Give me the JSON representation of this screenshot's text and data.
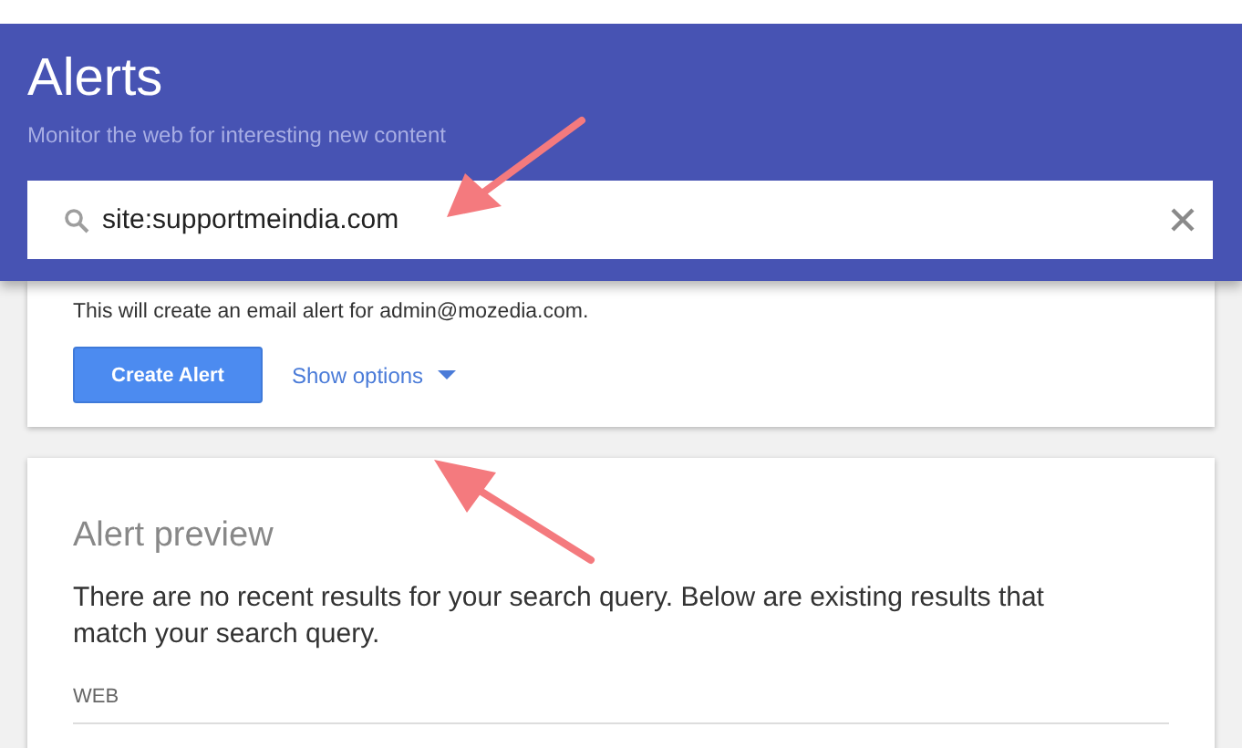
{
  "header": {
    "title": "Alerts",
    "subtitle": "Monitor the web for interesting new content"
  },
  "search": {
    "value": "site:supportmeindia.com"
  },
  "create_card": {
    "info": "This will create an email alert for admin@mozedia.com.",
    "create_button": "Create Alert",
    "options_link": "Show options",
    "options_expanded": false
  },
  "preview": {
    "title": "Alert preview",
    "message": "There are no recent results for your search query. Below are existing results that match your search query.",
    "section": "WEB"
  }
}
